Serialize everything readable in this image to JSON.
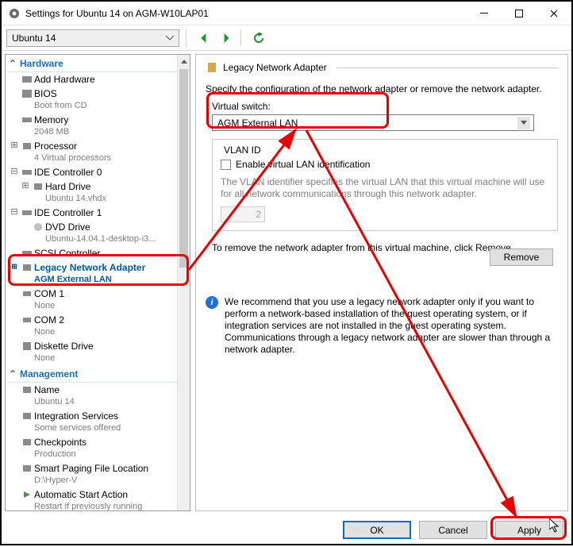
{
  "window": {
    "title": "Settings for Ubuntu 14 on AGM-W10LAP01"
  },
  "toolbar": {
    "vm_name": "Ubuntu 14"
  },
  "sidebar": {
    "sections": {
      "hardware": "Hardware",
      "management": "Management"
    },
    "hardware": [
      {
        "label": "Add Hardware",
        "sub": ""
      },
      {
        "label": "BIOS",
        "sub": "Boot from CD"
      },
      {
        "label": "Memory",
        "sub": "2048 MB"
      },
      {
        "label": "Processor",
        "sub": "4 Virtual processors"
      },
      {
        "label": "IDE Controller 0",
        "sub": ""
      },
      {
        "label": "Hard Drive",
        "sub": "Ubuntu 14.vhdx"
      },
      {
        "label": "IDE Controller 1",
        "sub": ""
      },
      {
        "label": "DVD Drive",
        "sub": "Ubuntu-14.04.1-desktop-i3..."
      },
      {
        "label": "SCSI Controller",
        "sub": ""
      },
      {
        "label": "Legacy Network Adapter",
        "sub": "AGM External LAN"
      },
      {
        "label": "COM 1",
        "sub": "None"
      },
      {
        "label": "COM 2",
        "sub": "None"
      },
      {
        "label": "Diskette Drive",
        "sub": "None"
      }
    ],
    "management": [
      {
        "label": "Name",
        "sub": "Ubuntu 14"
      },
      {
        "label": "Integration Services",
        "sub": "Some services offered"
      },
      {
        "label": "Checkpoints",
        "sub": "Production"
      },
      {
        "label": "Smart Paging File Location",
        "sub": "D:\\Hyper-V"
      },
      {
        "label": "Automatic Start Action",
        "sub": "Restart if previously running"
      }
    ]
  },
  "rhs": {
    "header": "Legacy Network Adapter",
    "intro": "Specify the configuration of the network adapter or remove the network adapter.",
    "virtual_switch_label": "Virtual switch:",
    "virtual_switch_value": "AGM External LAN",
    "vlan_group_title": "VLAN ID",
    "vlan_checkbox_label": "Enable virtual LAN identification",
    "vlan_help": "The VLAN identifier specifies the virtual LAN that this virtual machine will use for all network communications through this network adapter.",
    "vlan_value": "2",
    "remove_text": "To remove the network adapter from this virtual machine, click Remove.",
    "remove_button": "Remove",
    "info_text": "We recommend that you use a legacy network adapter only if you want to perform a network-based installation of the guest operating system, or if integration services are not installed in the guest operating system. Communications through a legacy network adapter are slower than through a network adapter."
  },
  "buttons": {
    "ok": "OK",
    "cancel": "Cancel",
    "apply": "Apply"
  }
}
